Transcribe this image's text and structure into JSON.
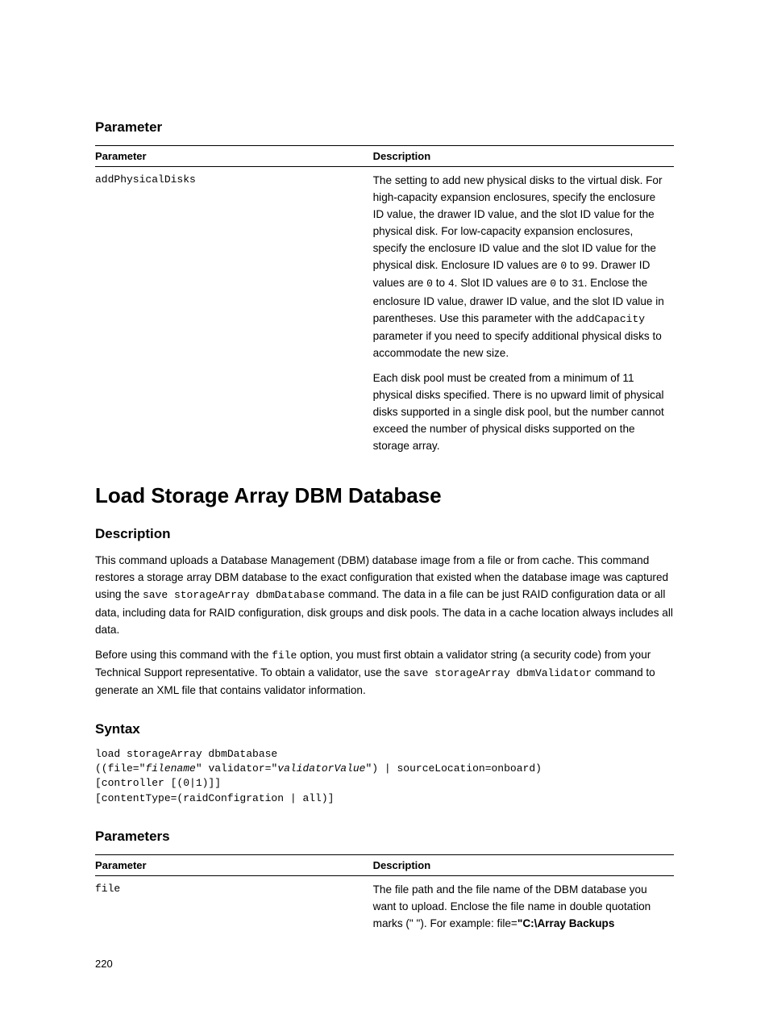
{
  "section1": {
    "heading": "Parameter",
    "table": {
      "headers": [
        "Parameter",
        "Description"
      ],
      "row": {
        "param": "addPhysicalDisks",
        "desc_parts": {
          "d1a": "The setting to add new physical disks to the virtual disk. For high-capacity expansion enclosures, specify the enclosure ID value, the drawer ID value, and the slot ID value for the physical disk. For low-capacity expansion enclosures, specify the enclosure ID value and the slot ID value for the physical disk. Enclosure ID values are ",
          "m1": "0",
          "d1b": " to ",
          "m2": "99",
          "d1c": ". Drawer ID values are ",
          "m3": "0",
          "d1d": " to ",
          "m4": "4",
          "d1e": ". Slot ID values are ",
          "m5": "0",
          "d1f": " to ",
          "m6": "31",
          "d1g": ". Enclose the enclosure ID value, drawer ID value, and the slot ID value in parentheses. Use this parameter with the ",
          "m7": "addCapacity",
          "d1h": " parameter if you need to specify additional physical disks to accommodate the new size.",
          "p2": "Each disk pool must be created from a minimum of 11 physical disks specified. There is no upward limit of physical disks supported in a single disk pool, but the number cannot exceed the number of physical disks supported on the storage array."
        }
      }
    }
  },
  "section2": {
    "heading": "Load Storage Array DBM Database",
    "sub1": {
      "heading": "Description",
      "p1a": "This command uploads a Database Management (DBM) database image from a file or from cache. This command restores a storage array DBM database to the exact configuration that existed when the database image was captured using the ",
      "m1": "save storageArray dbmDatabase",
      "p1b": " command. The data in a file can be just RAID configuration data or all data, including data for RAID configuration, disk groups and disk pools. The data in a cache location always includes all data.",
      "p2a": "Before using this command with the ",
      "m2": "file",
      "p2b": " option, you must first obtain a validator string (a security code) from your Technical Support representative. To obtain a validator, use the ",
      "m3": "save storageArray dbmValidator",
      "p2c": " command to generate an XML file that contains validator information."
    },
    "sub2": {
      "heading": "Syntax",
      "code": {
        "l1": "load storageArray dbmDatabase",
        "l2a": "((file=\"",
        "l2b": "filename",
        "l2c": "\" validator=\"",
        "l2d": "validatorValue",
        "l2e": "\") | sourceLocation=onboard)",
        "l3": "[controller [(0|1)]]",
        "l4": "[contentType=(raidConfigration | all)]"
      }
    },
    "sub3": {
      "heading": "Parameters",
      "table": {
        "headers": [
          "Parameter",
          "Description"
        ],
        "row": {
          "param": "file",
          "d1": "The file path and the file name of the DBM database you want to upload. Enclose the file name in double quotation marks (\" \"). For example: file=",
          "bold": "\"C:\\Array Backups"
        }
      }
    }
  },
  "page_number": "220"
}
